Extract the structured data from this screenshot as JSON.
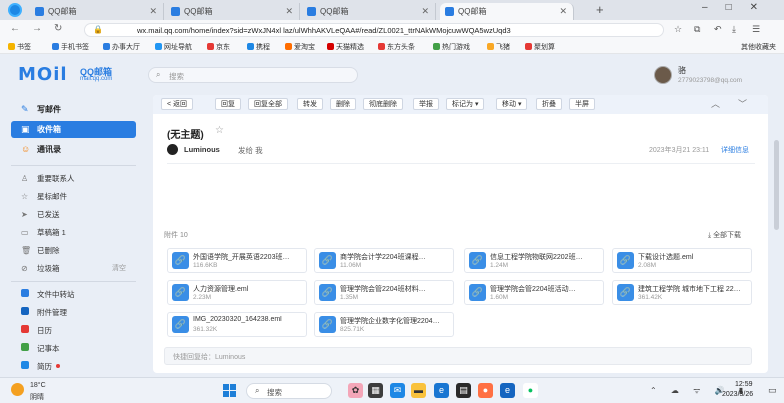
{
  "browser": {
    "tabs": [
      {
        "label": "QQ邮箱",
        "active": false
      },
      {
        "label": "QQ邮箱",
        "active": false
      },
      {
        "label": "QQ邮箱",
        "active": false
      },
      {
        "label": "QQ邮箱",
        "active": true
      }
    ],
    "url": "wx.mail.qq.com/home/index?sid=zWxJN4xl laz/ulWhhAKVLeQAA#/read/ZL0021_ttrNAkWMojcuwWQA5wzUqd3",
    "bookmarks": [
      "书签",
      "手机书签",
      "办事大厅",
      "网址导航",
      "京东",
      "携程",
      "爱淘宝",
      "天猫精选",
      "东方头条",
      "热门游戏",
      "飞猪",
      "聚划算"
    ],
    "other_bookmarks": "其他收藏夹"
  },
  "mail": {
    "logo_text": "MOil",
    "logo_cn": "QQ邮箱",
    "logo_domain": "mail.qq.com",
    "search_placeholder": "搜索",
    "user_name": "骆",
    "user_email": "2779023798@qq.com"
  },
  "sidebar": {
    "primary": [
      {
        "label": "写邮件",
        "icon": "pencil-icon",
        "active": false
      },
      {
        "label": "收件箱",
        "icon": "inbox-icon",
        "active": true
      },
      {
        "label": "通讯录",
        "icon": "contacts-icon",
        "active": false
      }
    ],
    "folders": [
      {
        "label": "重要联系人",
        "count": ""
      },
      {
        "label": "星标邮件",
        "count": ""
      },
      {
        "label": "已发送",
        "count": ""
      },
      {
        "label": "草稿箱 1",
        "count": ""
      },
      {
        "label": "已删除",
        "count": ""
      },
      {
        "label": "垃圾箱",
        "count": "清空"
      }
    ],
    "apps": [
      {
        "label": "文件中转站",
        "color": "#2a7de1"
      },
      {
        "label": "附件管理",
        "color": "#1565c0"
      },
      {
        "label": "日历",
        "color": "#e53935"
      },
      {
        "label": "记事本",
        "color": "#43a047"
      },
      {
        "label": "简历",
        "color": "#1e88e5",
        "dot": true
      }
    ]
  },
  "toolbar": {
    "buttons": [
      "< 返回",
      "回复",
      "回复全部",
      "转发",
      "删除",
      "彻底删除",
      "举报",
      "标记为 ▾",
      "移动 ▾",
      "折叠",
      "半屏"
    ]
  },
  "message": {
    "subject": "(无主题)",
    "sender": "Luminous",
    "sent_to_label": "发给",
    "recipient": "我",
    "date": "2023年3月21 23:11",
    "detail_link": "详细信息",
    "attachment_label": "附件 10",
    "download_all": "全部下载",
    "attachments": [
      {
        "name": "外国语学院_开展英语2203班…",
        "size": "116.6KB"
      },
      {
        "name": "商学院会计学2204班课程…",
        "size": "11.06M"
      },
      {
        "name": "信息工程学院物联网2202班…",
        "size": "1.24M"
      },
      {
        "name": "下载设计选题.eml",
        "size": "2.08M"
      },
      {
        "name": "人力资源管理.eml",
        "size": "2.23M"
      },
      {
        "name": "管理学院会管2204班材料…",
        "size": "1.35M"
      },
      {
        "name": "管理学院会管2204班活动…",
        "size": "1.60M"
      },
      {
        "name": "建筑工程学院 城市地下工程 22…",
        "size": "361.42K"
      },
      {
        "name": "IMG_20230320_164238.eml",
        "size": "361.32K"
      },
      {
        "name": "管理学院企业数字化管理2204…",
        "size": "825.71K"
      }
    ],
    "quick_reply_placeholder": "快捷回复给：Luminous"
  },
  "taskbar": {
    "weather_temp": "18°C",
    "weather_desc": "阴晴",
    "search_label": "搜索",
    "time": "12:59",
    "date": "2023/3/26"
  }
}
